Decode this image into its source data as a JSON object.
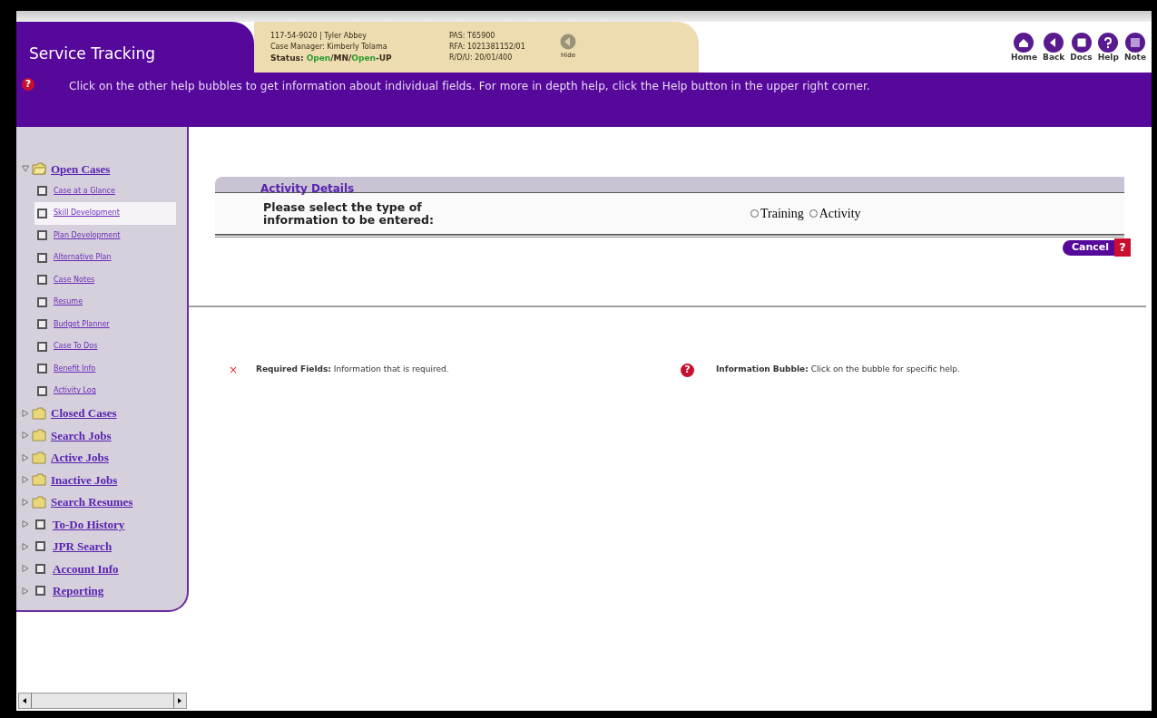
{
  "app_title": "Service Tracking",
  "case_info": {
    "line_1": "117-54-9020 | Tyler Abbey",
    "line_2": "Case Manager: Kimberly Tolama",
    "status_parts": [
      {
        "text": "Status: ",
        "color": "#3a2a1a"
      },
      {
        "text": "Open",
        "color": "#2f9a2f"
      },
      {
        "text": "/MN/",
        "color": "#3a2a1a"
      },
      {
        "text": "Open",
        "color": "#2f9a2f"
      },
      {
        "text": "-UP",
        "color": "#3a2a1a"
      }
    ],
    "line_4": "PAS: T65900",
    "line_5": "RFA: 1021381152/01",
    "line_6": "R/D/U: 20/01/400",
    "hide_label": "Hide"
  },
  "nav_buttons": [
    {
      "label": "Home",
      "kind": "home"
    },
    {
      "label": "Back",
      "kind": "back"
    },
    {
      "label": "Docs",
      "kind": "docs"
    },
    {
      "label": "Help",
      "kind": "help"
    },
    {
      "label": "Note",
      "kind": "note"
    }
  ],
  "help_text": "Click on the other help bubbles to get information about individual fields. For more in depth help, click the Help button in the upper right corner.",
  "sidebar": {
    "items": [
      {
        "label": "Open Cases",
        "kind": "folder",
        "expanded": true,
        "children": [
          {
            "label": "Case at a Glance",
            "selected": false
          },
          {
            "label": "Skill Development",
            "selected": true
          },
          {
            "label": "Plan Development",
            "selected": false
          },
          {
            "label": "Alternative Plan",
            "selected": false
          },
          {
            "label": "Case Notes",
            "selected": false
          },
          {
            "label": "Resume",
            "selected": false
          },
          {
            "label": "Budget Planner",
            "selected": false
          },
          {
            "label": "Case To Dos",
            "selected": false
          },
          {
            "label": "Benefit Info",
            "selected": false
          },
          {
            "label": "Activity Log",
            "selected": false
          }
        ]
      },
      {
        "label": "Closed Cases",
        "kind": "folder",
        "expanded": false
      },
      {
        "label": "Search Jobs",
        "kind": "folder",
        "expanded": false
      },
      {
        "label": "Active Jobs",
        "kind": "folder",
        "expanded": false
      },
      {
        "label": "Inactive Jobs",
        "kind": "folder",
        "expanded": false
      },
      {
        "label": "Search Resumes",
        "kind": "folder",
        "expanded": false
      },
      {
        "label": "To-Do History",
        "kind": "page",
        "expanded": false
      },
      {
        "label": "JPR Search",
        "kind": "page",
        "expanded": false
      },
      {
        "label": "Account Info",
        "kind": "page",
        "expanded": false
      },
      {
        "label": "Reporting",
        "kind": "page",
        "expanded": false
      }
    ]
  },
  "panel": {
    "title": "Activity Details",
    "prompt": "Please select the type of information to be entered:",
    "options": [
      {
        "label": "Training",
        "selected": false
      },
      {
        "label": "Activity",
        "selected": false
      }
    ],
    "cancel_label": "Cancel",
    "help_glyph": "?"
  },
  "legend": [
    {
      "kind": "required",
      "glyph": "×",
      "term": "Required Fields:",
      "text": " Information that is required."
    },
    {
      "kind": "bubble",
      "glyph": "?",
      "term": "Information Bubble:",
      "text": " Click on the bubble for specific help."
    }
  ],
  "help_glyph": "?"
}
